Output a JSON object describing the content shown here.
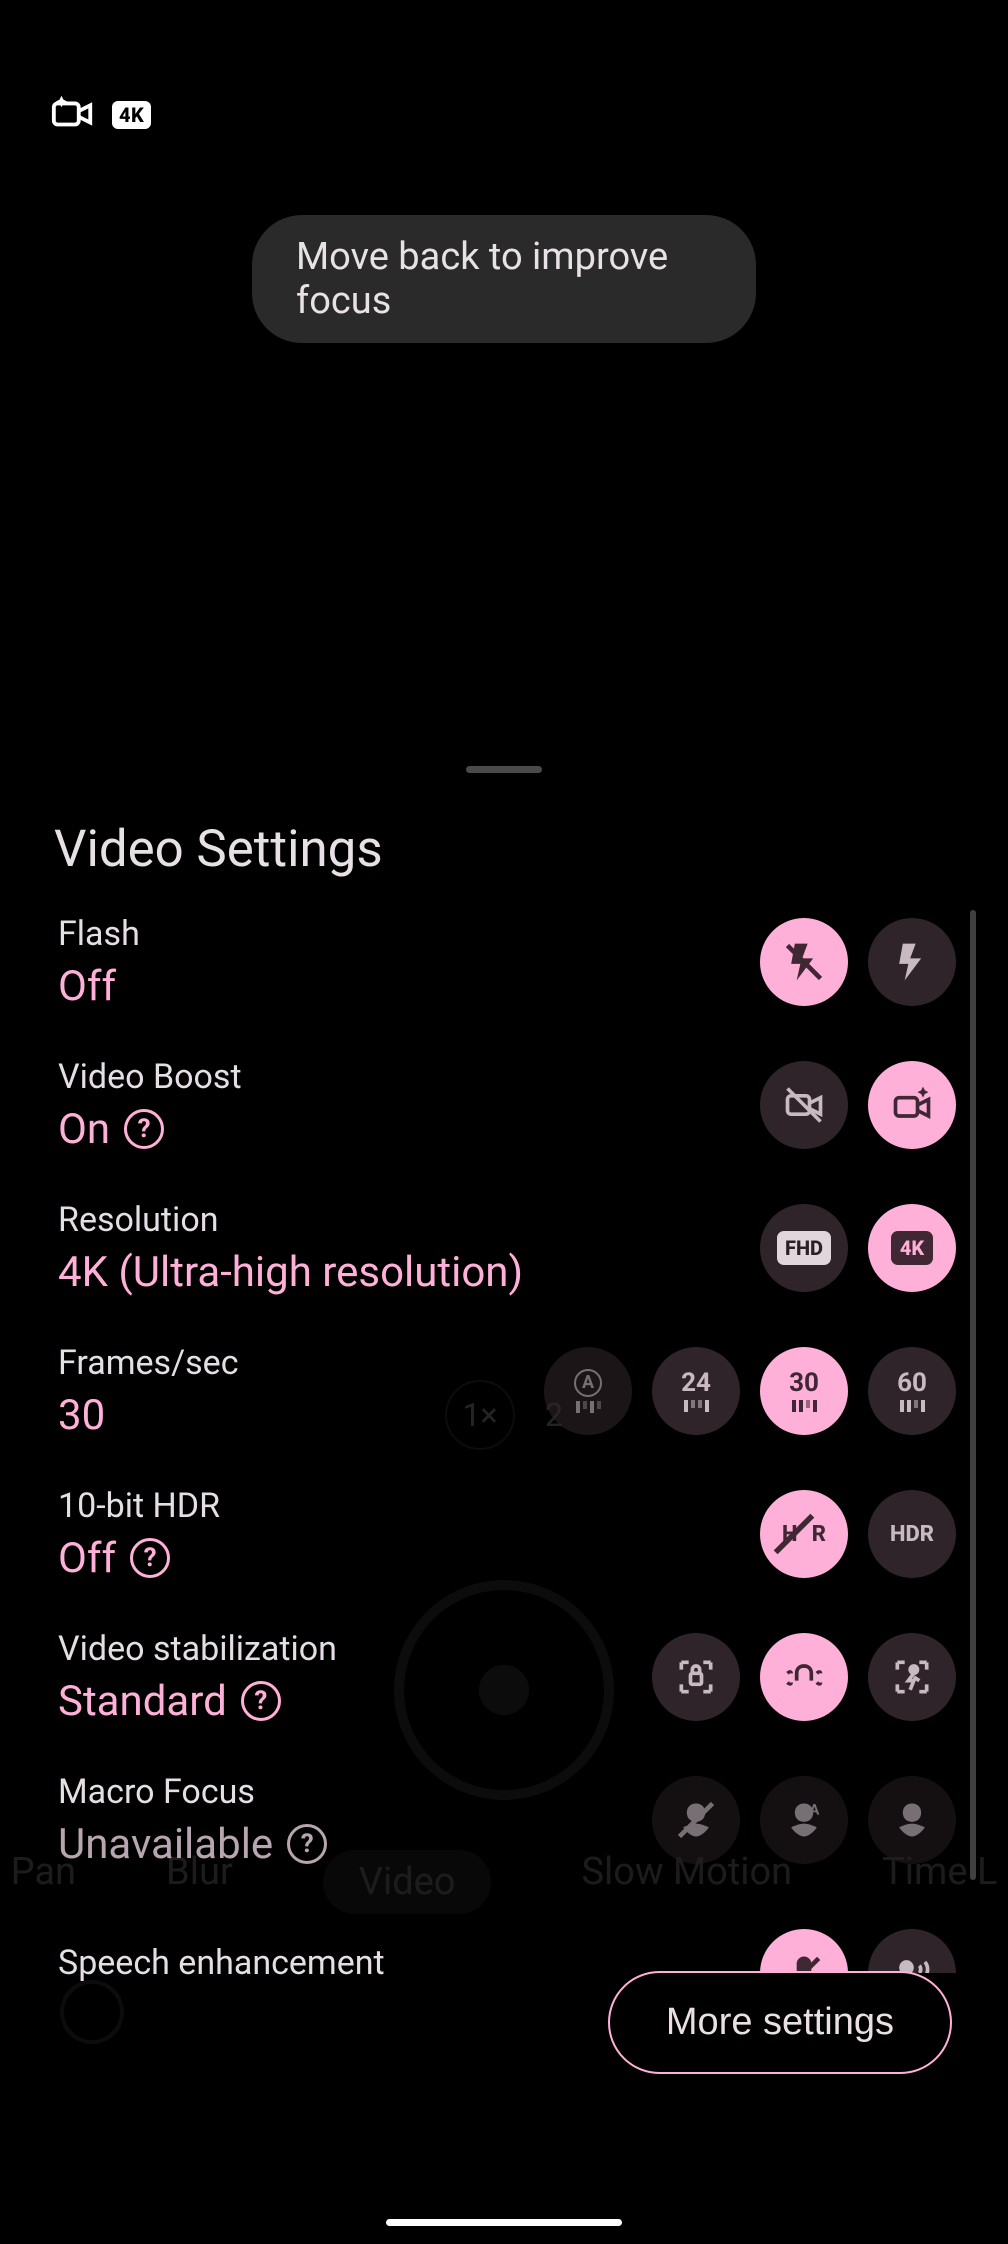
{
  "top": {
    "boost_icon": "video-boost-icon",
    "res_badge": "4K"
  },
  "hint": "Move back to improve focus",
  "sheet": {
    "title": "Video Settings",
    "more_settings": "More settings"
  },
  "backdrop_modes": {
    "pan": "Pan",
    "blur": "Blur",
    "video": "Video",
    "slowmo": "Slow Motion",
    "timel": "Time L"
  },
  "backdrop_zoom": {
    "z1": "1×",
    "z2": "2"
  },
  "rows": {
    "flash": {
      "name": "Flash",
      "value": "Off"
    },
    "boost": {
      "name": "Video Boost",
      "value": "On"
    },
    "res": {
      "name": "Resolution",
      "value": "4K (Ultra-high resolution)"
    },
    "fps": {
      "name": "Frames/sec",
      "value": "30",
      "opts": {
        "auto": "A",
        "f24": "24",
        "f30": "30",
        "f60": "60"
      }
    },
    "hdr": {
      "name": "10-bit HDR",
      "value": "Off"
    },
    "stab": {
      "name": "Video stabilization",
      "value": "Standard"
    },
    "macro": {
      "name": "Macro Focus",
      "value": "Unavailable"
    },
    "speech": {
      "name": "Speech enhancement"
    }
  },
  "chip_labels": {
    "fhd": "FHD",
    "k4": "4K",
    "hdr": "HDR"
  }
}
